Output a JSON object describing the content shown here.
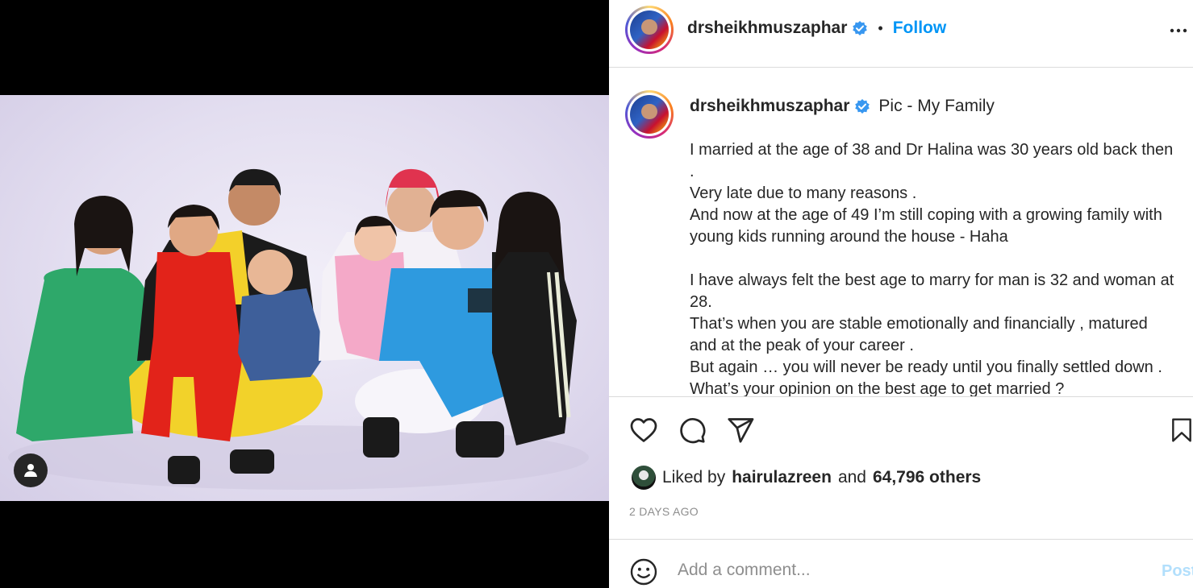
{
  "post": {
    "username": "drsheikhmuszaphar",
    "follow_label": "Follow",
    "separator": "•",
    "caption_subtitle": "Pic - My Family",
    "caption_lines": [
      "I married at the age of 38 and Dr Halina was 30 years old back then",
      ".",
      "Very late due to many reasons .",
      "And now at the age of 49 I’m still coping with a growing family with",
      "young kids running around the house - Haha",
      "",
      "I have always felt the best age to marry for man is 32 and woman at",
      "28.",
      "That’s when you are stable emotionally and financially , matured",
      "and at the peak of your career .",
      "But again … you will never be ready until you finally settled down .",
      "What’s your opinion on the best age to get married ?"
    ],
    "liked_by_prefix": "Liked by",
    "liked_by_user": "hairulazreen",
    "liked_by_and": "and",
    "liked_by_count": "64,796 others",
    "timestamp": "2 DAYS AGO"
  },
  "comment": {
    "placeholder": "Add a comment...",
    "post_label": "Post"
  },
  "icons": {
    "verified": "verified-badge-icon",
    "more": "more-options-icon",
    "like": "heart-icon",
    "comment": "comment-bubble-icon",
    "share": "paper-plane-icon",
    "save": "bookmark-icon",
    "emoji": "smiley-icon",
    "tag": "user-tag-icon"
  },
  "colors": {
    "link_blue": "#0095f6",
    "verified_blue": "#3897f0",
    "post_disabled": "#b2dffc",
    "muted": "#8e8e8e",
    "divider": "#dbdbdb"
  }
}
